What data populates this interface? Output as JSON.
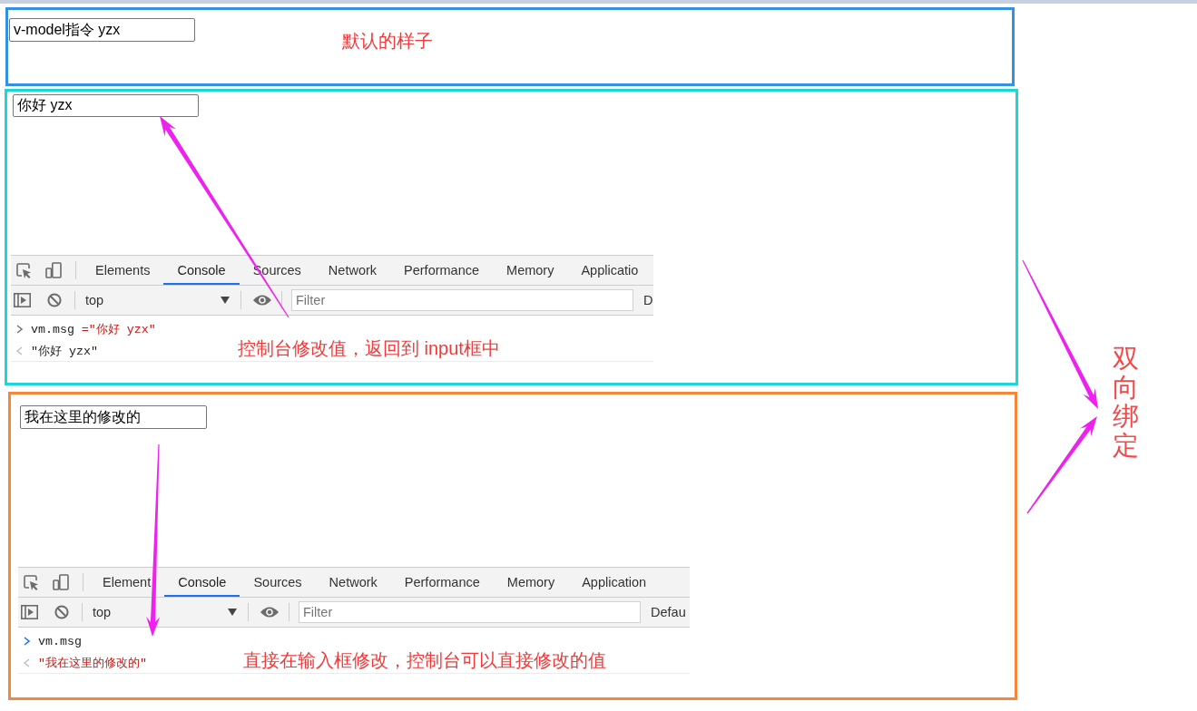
{
  "panels": [
    {
      "color": "#3391e3",
      "input": {
        "value": "v-model指令 yzx"
      },
      "note": "默认的样子"
    },
    {
      "color": "#1dd6d8",
      "input": {
        "value": "你好 yzx"
      },
      "devtools": {
        "tabs": [
          {
            "label": "Elements",
            "selected": false
          },
          {
            "label": "Console",
            "selected": true
          },
          {
            "label": "Sources",
            "selected": false
          },
          {
            "label": "Network",
            "selected": false
          },
          {
            "label": "Performance",
            "selected": false
          },
          {
            "label": "Memory",
            "selected": false
          },
          {
            "label": "Applicatio",
            "selected": false
          }
        ],
        "toolbar": {
          "context": "top",
          "filter": {
            "placeholder": "Filter"
          },
          "levels": "D"
        },
        "console": [
          {
            "kind": "command",
            "active": false,
            "segments": [
              {
                "kind": "code",
                "text": "vm.msg "
              },
              {
                "kind": "string",
                "text": "=\"你好 yzx\""
              }
            ]
          },
          {
            "kind": "result",
            "active": false,
            "segments": [
              {
                "kind": "code",
                "text": "\"你好 yzx\""
              }
            ]
          }
        ]
      },
      "note": "控制台修改值，返回到 input框中"
    },
    {
      "color": "#f5863a",
      "input": {
        "value": "我在这里的修改的"
      },
      "devtools": {
        "tabs": [
          {
            "label": "Element",
            "selected": false
          },
          {
            "label": "Console",
            "selected": true
          },
          {
            "label": "Sources",
            "selected": false
          },
          {
            "label": "Network",
            "selected": false
          },
          {
            "label": "Performance",
            "selected": false
          },
          {
            "label": "Memory",
            "selected": false
          },
          {
            "label": "Application",
            "selected": false
          }
        ],
        "toolbar": {
          "context": "top",
          "filter": {
            "placeholder": "Filter"
          },
          "levels": "Defau"
        },
        "console": [
          {
            "kind": "command",
            "active": true,
            "segments": [
              {
                "kind": "code",
                "text": "vm.msg"
              }
            ]
          },
          {
            "kind": "result",
            "active": false,
            "segments": [
              {
                "kind": "string",
                "text": "\"我在这里的修改的\""
              }
            ]
          }
        ]
      },
      "note": "直接在输入框修改，控制台可以直接修改的值"
    }
  ],
  "side_note": "双向绑定"
}
